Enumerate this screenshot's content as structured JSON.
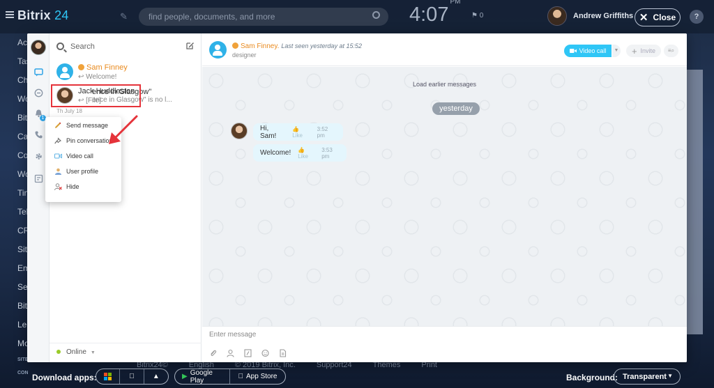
{
  "topbar": {
    "logo_main": "Bitrix",
    "logo_num": "24",
    "search_placeholder": "find people, documents, and more",
    "clock_time": "4:07",
    "clock_ampm": "PM",
    "flag_count": "0",
    "user_name": "Andrew Griffiths",
    "close_label": "Close",
    "help_label": "?"
  },
  "bg_menu": [
    "Ac",
    "Tas",
    "Ch",
    "Wo",
    "Bit",
    "Ca",
    "Co",
    "Wo",
    "Tin",
    "Tel",
    "CR",
    "Sit",
    "Em",
    "Se",
    "Bit",
    "Le",
    "Mo"
  ],
  "bg_menu_site": "SITE",
  "bg_menu_conf": "CONFIGUR",
  "footer": {
    "links": [
      "Bitrix24©",
      "English",
      "© 2019 Bitrix, Inc.",
      "Support24",
      "Themes",
      "Print"
    ],
    "download_label": "Download apps:",
    "google_play": "Google Play",
    "app_store": "App Store",
    "background_label": "Background:",
    "background_value": "Transparent"
  },
  "contacts": {
    "search_placeholder": "Search",
    "items": [
      {
        "name": "Sam Finney",
        "sub": "Welcome!"
      },
      {
        "name": "Jack Huddleston",
        "sub": "[File]"
      }
    ],
    "date_fragment": "Th   July 18",
    "msg_fragment_title": "ence in Glasgow\"",
    "msg_fragment_sub": "ence in Glasgow\" is no l...",
    "status": "Online"
  },
  "context_menu": {
    "items": [
      "Send message",
      "Pin conversation",
      "Video call",
      "User profile",
      "Hide"
    ]
  },
  "chat": {
    "header_name": "Sam Finney.",
    "last_seen": "Last seen yesterday at 15:52",
    "role": "designer",
    "video_call": "Video call",
    "invite": "Invite",
    "load_earlier": "Load earlier messages",
    "date_label": "yesterday",
    "messages": [
      {
        "text": "Hi, Sam!",
        "like": "Like",
        "time": "3:52 pm"
      },
      {
        "text": "Welcome!",
        "like": "Like",
        "time": "3:53 pm"
      }
    ],
    "input_placeholder": "Enter message"
  },
  "colors": {
    "accent": "#2fc6f6",
    "highlight": "#e5333a",
    "online": "#9acb29",
    "extranet_name": "#e98a1e"
  }
}
